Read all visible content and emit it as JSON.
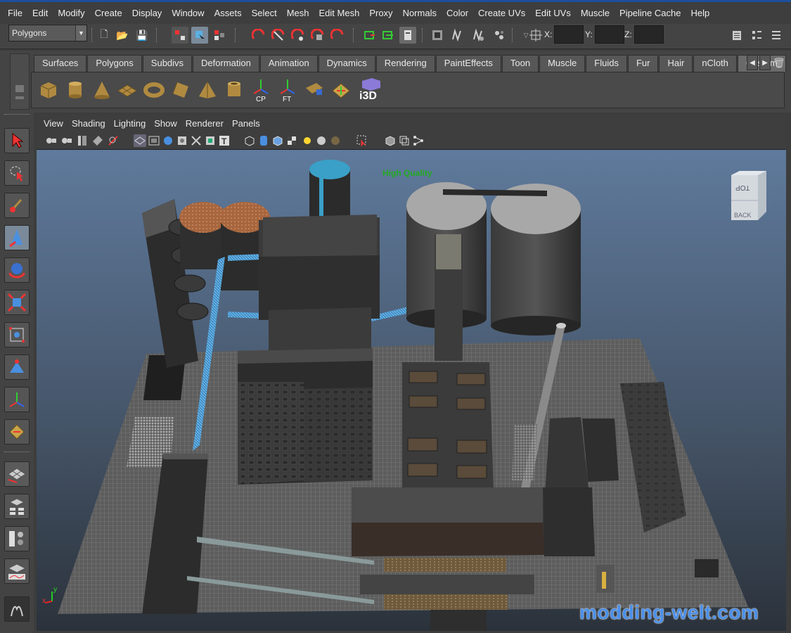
{
  "menu": [
    "File",
    "Edit",
    "Modify",
    "Create",
    "Display",
    "Window",
    "Assets",
    "Select",
    "Mesh",
    "Edit Mesh",
    "Proxy",
    "Normals",
    "Color",
    "Create UVs",
    "Edit UVs",
    "Muscle",
    "Pipeline Cache",
    "Help"
  ],
  "status_line": {
    "menu_set": "Polygons",
    "coord_labels": [
      "X:",
      "Y:",
      "Z:"
    ]
  },
  "shelf_tabs": [
    "Surfaces",
    "Polygons",
    "Subdivs",
    "Deformation",
    "Animation",
    "Dynamics",
    "Rendering",
    "PaintEffects",
    "Toon",
    "Muscle",
    "Fluids",
    "Fur",
    "Hair",
    "nCloth",
    "Custom"
  ],
  "active_shelf_tab": "Custom",
  "shelf_icons": {
    "cp_label": "CP",
    "ft_label": "FT",
    "i3d_label": "i3D"
  },
  "panel_menu": [
    "View",
    "Shading",
    "Lighting",
    "Show",
    "Renderer",
    "Panels"
  ],
  "viewport": {
    "hud_text": "High Quality",
    "viewcube_top": "TOP",
    "viewcube_back": "BACK",
    "watermark": "modding-welt.com",
    "axis_x": "x",
    "axis_y": "y"
  },
  "colors": {
    "accent": "#1c4f9c",
    "hud": "#22aa22",
    "watermark": "#4a8fe8"
  }
}
